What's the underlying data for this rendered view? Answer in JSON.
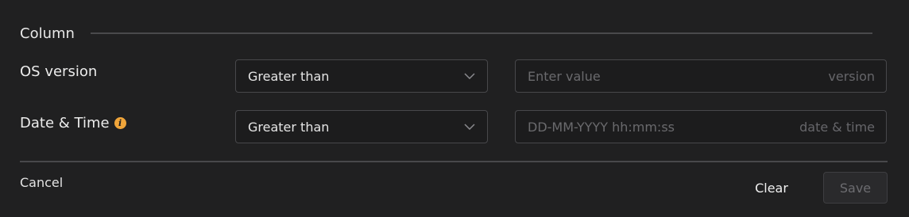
{
  "section": {
    "title": "Column"
  },
  "filters": [
    {
      "label": "OS version",
      "operator": "Greater than",
      "placeholder": "Enter value",
      "suffix": "version",
      "has_info_icon": false
    },
    {
      "label": "Date & Time",
      "operator": "Greater than",
      "placeholder": "DD-MM-YYYY hh:mm:ss",
      "suffix": "date & time",
      "has_info_icon": true,
      "info_icon": "info-icon",
      "info_icon_glyph": "i"
    }
  ],
  "footer": {
    "cancel_label": "Cancel",
    "clear_label": "Clear",
    "save_label": "Save"
  },
  "colors": {
    "background": "#202021",
    "info_accent": "#f0a53a",
    "border": "#48484b",
    "save_disabled_text": "#6c6c70"
  }
}
